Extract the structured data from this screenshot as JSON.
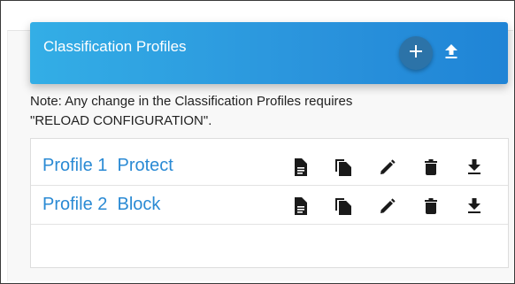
{
  "header": {
    "title": "Classification Profiles",
    "add_icon": "plus-icon",
    "upload_icon": "upload-icon"
  },
  "note": {
    "line1": "Note: Any change in the Classification Profiles requires",
    "line2": "\"RELOAD CONFIGURATION\"."
  },
  "profiles": [
    {
      "id": "Profile 1",
      "action": "Protect",
      "label": "Profile 1  Protect"
    },
    {
      "id": "Profile 2",
      "action": "Block",
      "label": "Profile 2  Block"
    }
  ],
  "row_actions": [
    "view-icon",
    "copy-icon",
    "edit-icon",
    "delete-icon",
    "download-icon"
  ],
  "colors": {
    "header_start": "#33aee6",
    "header_end": "#1f84d6",
    "add_button": "#2c73a8",
    "link": "#2a8ad4",
    "icon": "#1a1a1a"
  }
}
